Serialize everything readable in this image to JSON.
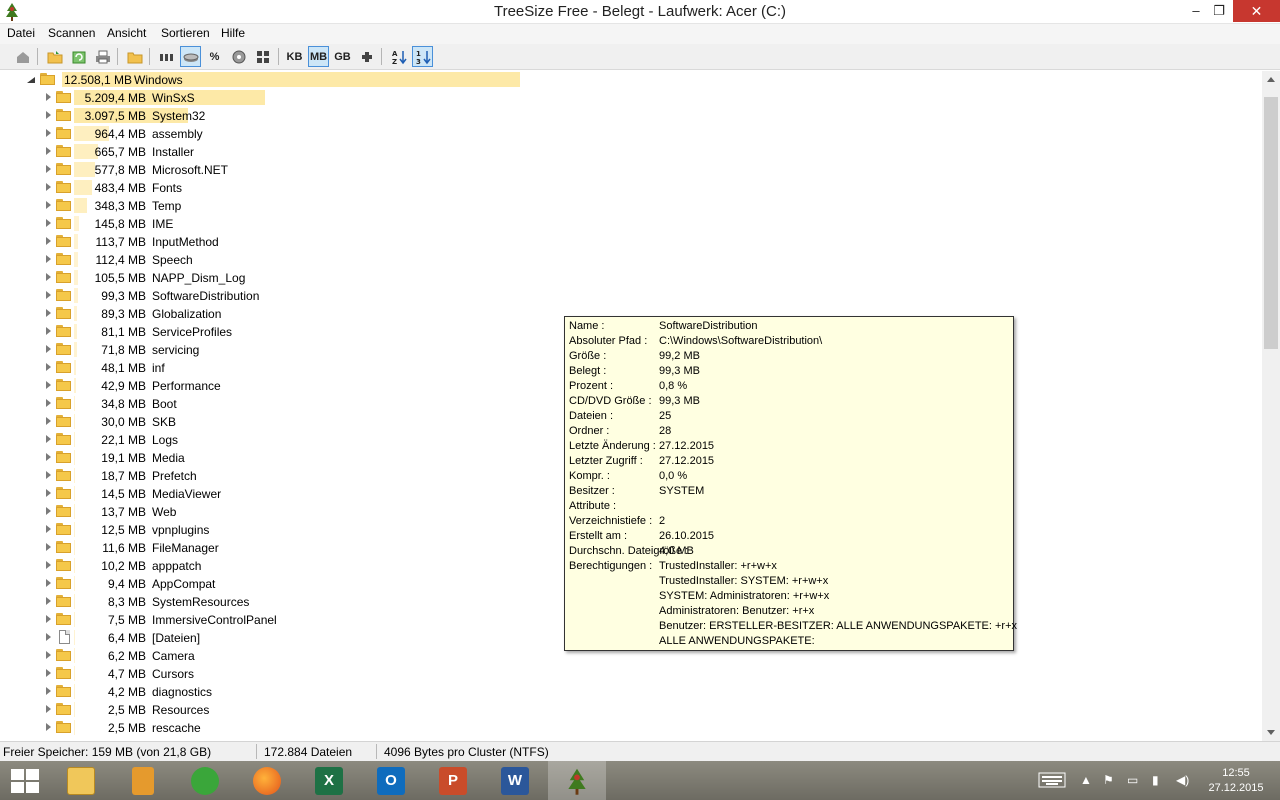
{
  "window": {
    "title": "TreeSize Free - Belegt - Laufwerk: Acer (C:)",
    "controls": {
      "minimize": "–",
      "maximize": "❐",
      "close": "✕"
    }
  },
  "menu": [
    "Datei",
    "Scannen",
    "Ansicht",
    "Sortieren",
    "Hilfe"
  ],
  "toolbar": {
    "units": {
      "kb": "KB",
      "mb": "MB",
      "gb": "GB"
    },
    "percent": "%",
    "active_unit": "MB",
    "icons": [
      "home-icon",
      "open-folder-icon",
      "refresh-icon",
      "print-icon",
      "folder-browse-icon",
      "size-view-icon",
      "disk-view-icon",
      "percent-view-icon",
      "disk-space-icon",
      "grid-view-icon",
      "kb-unit",
      "mb-unit",
      "gb-unit",
      "auto-unit-icon",
      "sort-alpha-icon",
      "sort-size-icon"
    ]
  },
  "tree": {
    "root": {
      "size": "12.508,1 MB",
      "name": "Windows"
    },
    "items": [
      {
        "size": "5.209,4 MB",
        "name": "WinSxS",
        "type": "folder"
      },
      {
        "size": "3.097,5 MB",
        "name": "System32",
        "type": "folder"
      },
      {
        "size": "964,4 MB",
        "name": "assembly",
        "type": "folder"
      },
      {
        "size": "665,7 MB",
        "name": "Installer",
        "type": "folder"
      },
      {
        "size": "577,8 MB",
        "name": "Microsoft.NET",
        "type": "folder"
      },
      {
        "size": "483,4 MB",
        "name": "Fonts",
        "type": "folder"
      },
      {
        "size": "348,3 MB",
        "name": "Temp",
        "type": "folder"
      },
      {
        "size": "145,8 MB",
        "name": "IME",
        "type": "folder"
      },
      {
        "size": "113,7 MB",
        "name": "InputMethod",
        "type": "folder"
      },
      {
        "size": "112,4 MB",
        "name": "Speech",
        "type": "folder"
      },
      {
        "size": "105,5 MB",
        "name": "NAPP_Dism_Log",
        "type": "folder"
      },
      {
        "size": "99,3 MB",
        "name": "SoftwareDistribution",
        "type": "folder"
      },
      {
        "size": "89,3 MB",
        "name": "Globalization",
        "type": "folder"
      },
      {
        "size": "81,1 MB",
        "name": "ServiceProfiles",
        "type": "folder"
      },
      {
        "size": "71,8 MB",
        "name": "servicing",
        "type": "folder"
      },
      {
        "size": "48,1 MB",
        "name": "inf",
        "type": "folder"
      },
      {
        "size": "42,9 MB",
        "name": "Performance",
        "type": "folder"
      },
      {
        "size": "34,8 MB",
        "name": "Boot",
        "type": "folder"
      },
      {
        "size": "30,0 MB",
        "name": "SKB",
        "type": "folder"
      },
      {
        "size": "22,1 MB",
        "name": "Logs",
        "type": "folder"
      },
      {
        "size": "19,1 MB",
        "name": "Media",
        "type": "folder"
      },
      {
        "size": "18,7 MB",
        "name": "Prefetch",
        "type": "folder"
      },
      {
        "size": "14,5 MB",
        "name": "MediaViewer",
        "type": "folder"
      },
      {
        "size": "13,7 MB",
        "name": "Web",
        "type": "folder"
      },
      {
        "size": "12,5 MB",
        "name": "vpnplugins",
        "type": "folder"
      },
      {
        "size": "11,6 MB",
        "name": "FileManager",
        "type": "folder"
      },
      {
        "size": "10,2 MB",
        "name": "apppatch",
        "type": "folder"
      },
      {
        "size": "9,4 MB",
        "name": "AppCompat",
        "type": "folder"
      },
      {
        "size": "8,3 MB",
        "name": "SystemResources",
        "type": "folder"
      },
      {
        "size": "7,5 MB",
        "name": "ImmersiveControlPanel",
        "type": "folder"
      },
      {
        "size": "6,4 MB",
        "name": "[Dateien]",
        "type": "file"
      },
      {
        "size": "6,2 MB",
        "name": "Camera",
        "type": "folder"
      },
      {
        "size": "4,7 MB",
        "name": "Cursors",
        "type": "folder"
      },
      {
        "size": "4,2 MB",
        "name": "diagnostics",
        "type": "folder"
      },
      {
        "size": "2,5 MB",
        "name": "Resources",
        "type": "folder"
      },
      {
        "size": "2,5 MB",
        "name": "rescache",
        "type": "folder"
      }
    ]
  },
  "tooltip": {
    "lines": [
      {
        "label": "Name :",
        "value": "SoftwareDistribution"
      },
      {
        "label": "Absoluter Pfad :",
        "value": "C:\\Windows\\SoftwareDistribution\\"
      },
      {
        "label": "Größe :",
        "value": "99,2 MB"
      },
      {
        "label": "Belegt :",
        "value": "99,3 MB"
      },
      {
        "label": "Prozent :",
        "value": "0,8 %"
      },
      {
        "label": "CD/DVD Größe :",
        "value": "99,3 MB"
      },
      {
        "label": "Dateien :",
        "value": "25"
      },
      {
        "label": "Ordner :",
        "value": "28"
      },
      {
        "label": "Letzte Änderung :",
        "value": "27.12.2015"
      },
      {
        "label": "Letzter Zugriff :",
        "value": "27.12.2015"
      },
      {
        "label": "Kompr. :",
        "value": "0,0 %"
      },
      {
        "label": "Besitzer :",
        "value": "SYSTEM"
      },
      {
        "label": "Attribute :",
        "value": ""
      },
      {
        "label": "Verzeichnistiefe :",
        "value": "2"
      },
      {
        "label": "Erstellt am :",
        "value": "26.10.2015"
      },
      {
        "label": "Durchschn. Dateigröße :",
        "value": "4,0 MB"
      },
      {
        "label": "Berechtigungen :",
        "value": "TrustedInstaller: +r+w+x"
      },
      {
        "label": "",
        "value": "TrustedInstaller: SYSTEM: +r+w+x"
      },
      {
        "label": "",
        "value": "SYSTEM: Administratoren: +r+w+x"
      },
      {
        "label": "",
        "value": "Administratoren: Benutzer: +r+x"
      },
      {
        "label": "",
        "value": "Benutzer: ERSTELLER-BESITZER: ALLE ANWENDUNGSPAKETE: +r+x"
      },
      {
        "label": "",
        "value": "ALLE ANWENDUNGSPAKETE:"
      }
    ]
  },
  "status": {
    "free": "Freier Speicher: 159 MB  (von 21,8 GB)",
    "files": "172.884  Dateien",
    "cluster": "4096 Bytes pro Cluster (NTFS)"
  },
  "taskbar": {
    "apps": [
      {
        "name": "file-explorer",
        "glyph": ""
      },
      {
        "name": "notes",
        "glyph": ""
      },
      {
        "name": "cloud-app",
        "glyph": ""
      },
      {
        "name": "firefox",
        "glyph": ""
      },
      {
        "name": "excel",
        "glyph": "X"
      },
      {
        "name": "outlook",
        "glyph": "O"
      },
      {
        "name": "powerpoint",
        "glyph": "P"
      },
      {
        "name": "word",
        "glyph": "W"
      },
      {
        "name": "treesize",
        "glyph": ""
      }
    ],
    "time": "12:55",
    "date": "27.12.2015"
  },
  "colors": {
    "bar": "#fde9a7",
    "tooltip_bg": "#ffffe1",
    "close_red": "#c7372f",
    "active_unit_bg": "#cde6f7"
  }
}
